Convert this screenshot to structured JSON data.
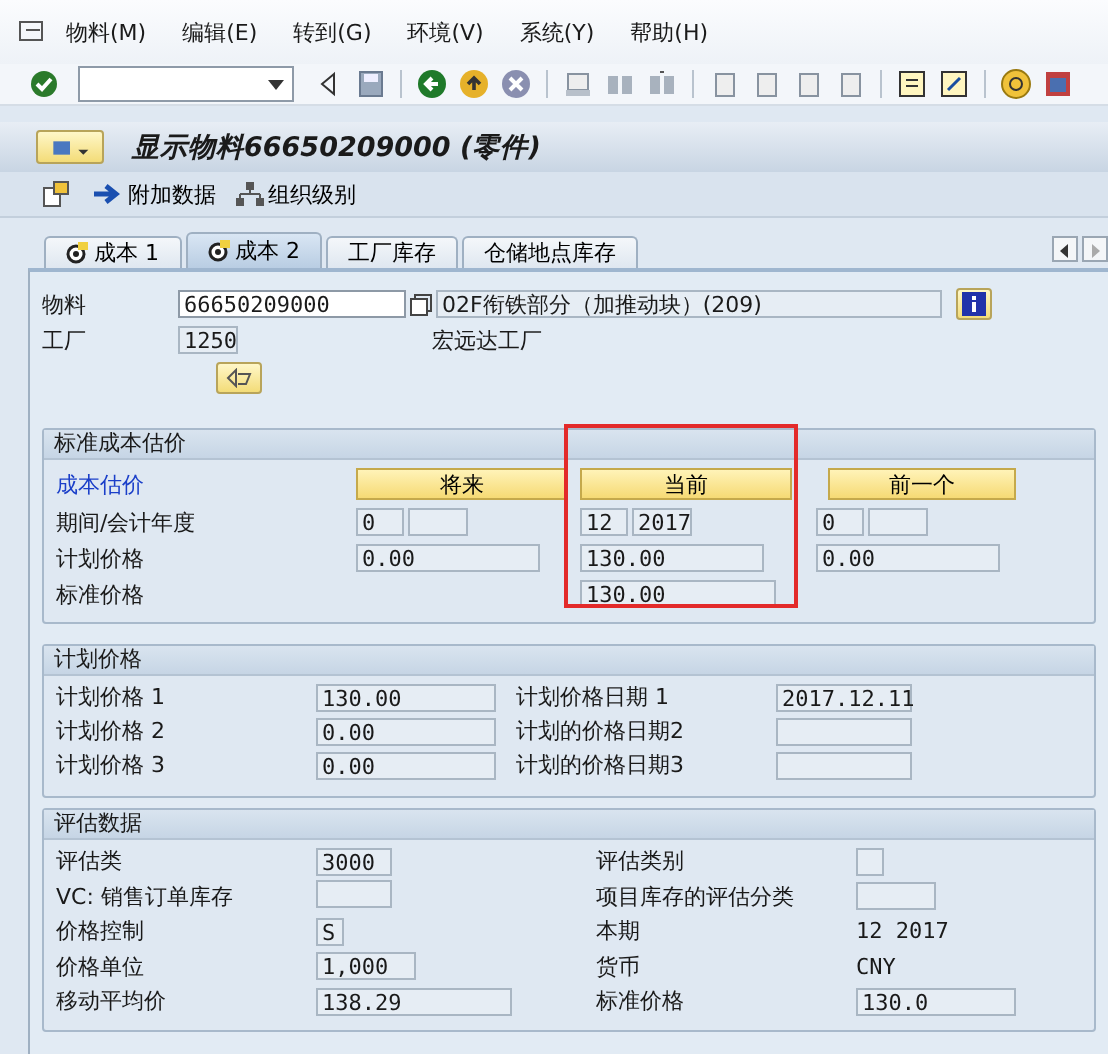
{
  "menu": [
    "物料(M)",
    "编辑(E)",
    "转到(G)",
    "环境(V)",
    "系统(Y)",
    "帮助(H)"
  ],
  "title": "显示物料66650209000 (零件)",
  "app_toolbar": [
    "附加数据",
    "组织级别"
  ],
  "tabs": [
    {
      "label": "成本 1",
      "selected": false
    },
    {
      "label": "成本 2",
      "selected": true
    },
    {
      "label": "工厂库存",
      "selected": false
    },
    {
      "label": "仓储地点库存",
      "selected": false
    }
  ],
  "header": {
    "material_label": "物料",
    "material": "66650209000",
    "material_desc": "02F衔铁部分（加推动块）(209)",
    "plant_label": "工厂",
    "plant": "1250",
    "plant_name": "宏远达工厂"
  },
  "standard_cost_estimate": {
    "title": "标准成本估价",
    "link": "成本估价",
    "row_labels": [
      "期间/会计年度",
      "计划价格",
      "标准价格"
    ],
    "columns": [
      {
        "button": "将来",
        "period": "0",
        "planned_price": "0.00",
        "highlighted": false
      },
      {
        "button": "当前",
        "period": "12",
        "year": "2017",
        "planned_price": "130.00",
        "standard_price": "130.00",
        "highlighted": true
      },
      {
        "button": "前一个",
        "period": "0",
        "planned_price": "0.00",
        "highlighted": false
      }
    ]
  },
  "planned_prices": {
    "title": "计划价格",
    "rows": [
      {
        "label": "计划价格 1",
        "value": "130.00",
        "date_label": "计划价格日期 1",
        "date": "2017.12.11"
      },
      {
        "label": "计划价格 2",
        "value": "0.00",
        "date_label": "计划的价格日期2"
      },
      {
        "label": "计划价格 3",
        "value": "0.00",
        "date_label": "计划的价格日期3"
      }
    ]
  },
  "valuation": {
    "title": "评估数据",
    "rows": [
      {
        "label": "评估类",
        "value": "3000",
        "right": {
          "label": "评估类别",
          "kind": "field"
        }
      },
      {
        "label": "VC: 销售订单库存",
        "right": {
          "label": "项目库存的评估分类",
          "kind": "field"
        }
      },
      {
        "label": "价格控制",
        "value": "S",
        "right": {
          "label": "本期",
          "kind": "text",
          "value": "12 2017"
        }
      },
      {
        "label": "价格单位",
        "value": "1,000",
        "right": {
          "label": "货币",
          "kind": "text",
          "value": "CNY"
        }
      },
      {
        "label": "移动平均价",
        "value": "138.29",
        "right": {
          "label": "标准价格",
          "kind": "field",
          "value": "130.0"
        }
      }
    ]
  }
}
